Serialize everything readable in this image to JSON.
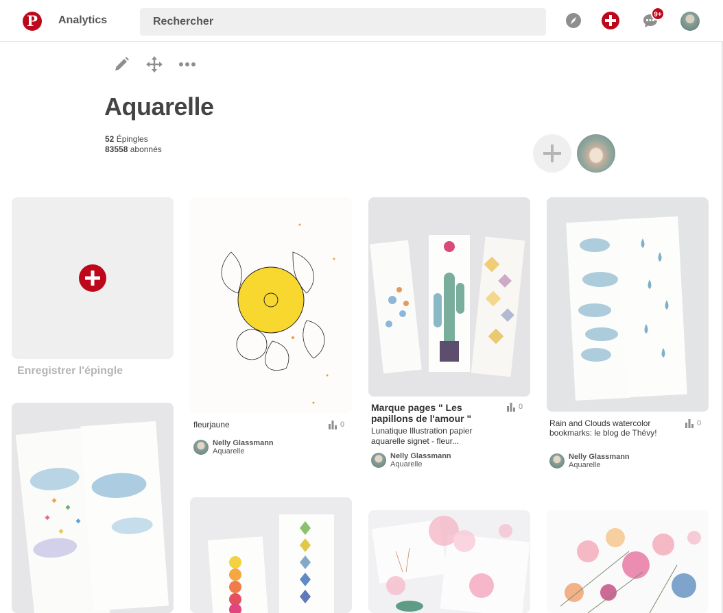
{
  "header": {
    "logo_letter": "P",
    "analytics_label": "Analytics",
    "search_placeholder": "Rechercher",
    "notification_badge": "9+",
    "icons": [
      "pinterest-logo",
      "compass-icon",
      "plus-icon",
      "speech-bubble-icon",
      "user-avatar"
    ]
  },
  "board": {
    "tools": [
      "pencil-icon",
      "move-arrows-icon",
      "ellipsis-icon"
    ],
    "title": "Aquarelle",
    "pins_count": "52",
    "pins_label": "Épingles",
    "followers_count": "83558",
    "followers_label": "abonnés"
  },
  "colors": {
    "brand": "#bd081c",
    "panel": "#efefef",
    "muted": "#b5b5b5"
  },
  "save_card": {
    "label": "Enregistrer l'épingle"
  },
  "pins": [
    {
      "title": "fleurjaune",
      "stat": "0",
      "pinner": "Nelly Glassmann",
      "board": "Aquarelle"
    },
    {
      "title": "Marque pages \" Les papillons de l'amour \"",
      "description": "Lunatique Illustration papier aquarelle signet - fleur...",
      "stat": "0",
      "pinner": "Nelly Glassmann",
      "board": "Aquarelle"
    },
    {
      "title": "Rain and Clouds watercolor bookmarks: le blog de Thévy!",
      "stat": "0",
      "pinner": "Nelly Glassmann",
      "board": "Aquarelle"
    }
  ]
}
